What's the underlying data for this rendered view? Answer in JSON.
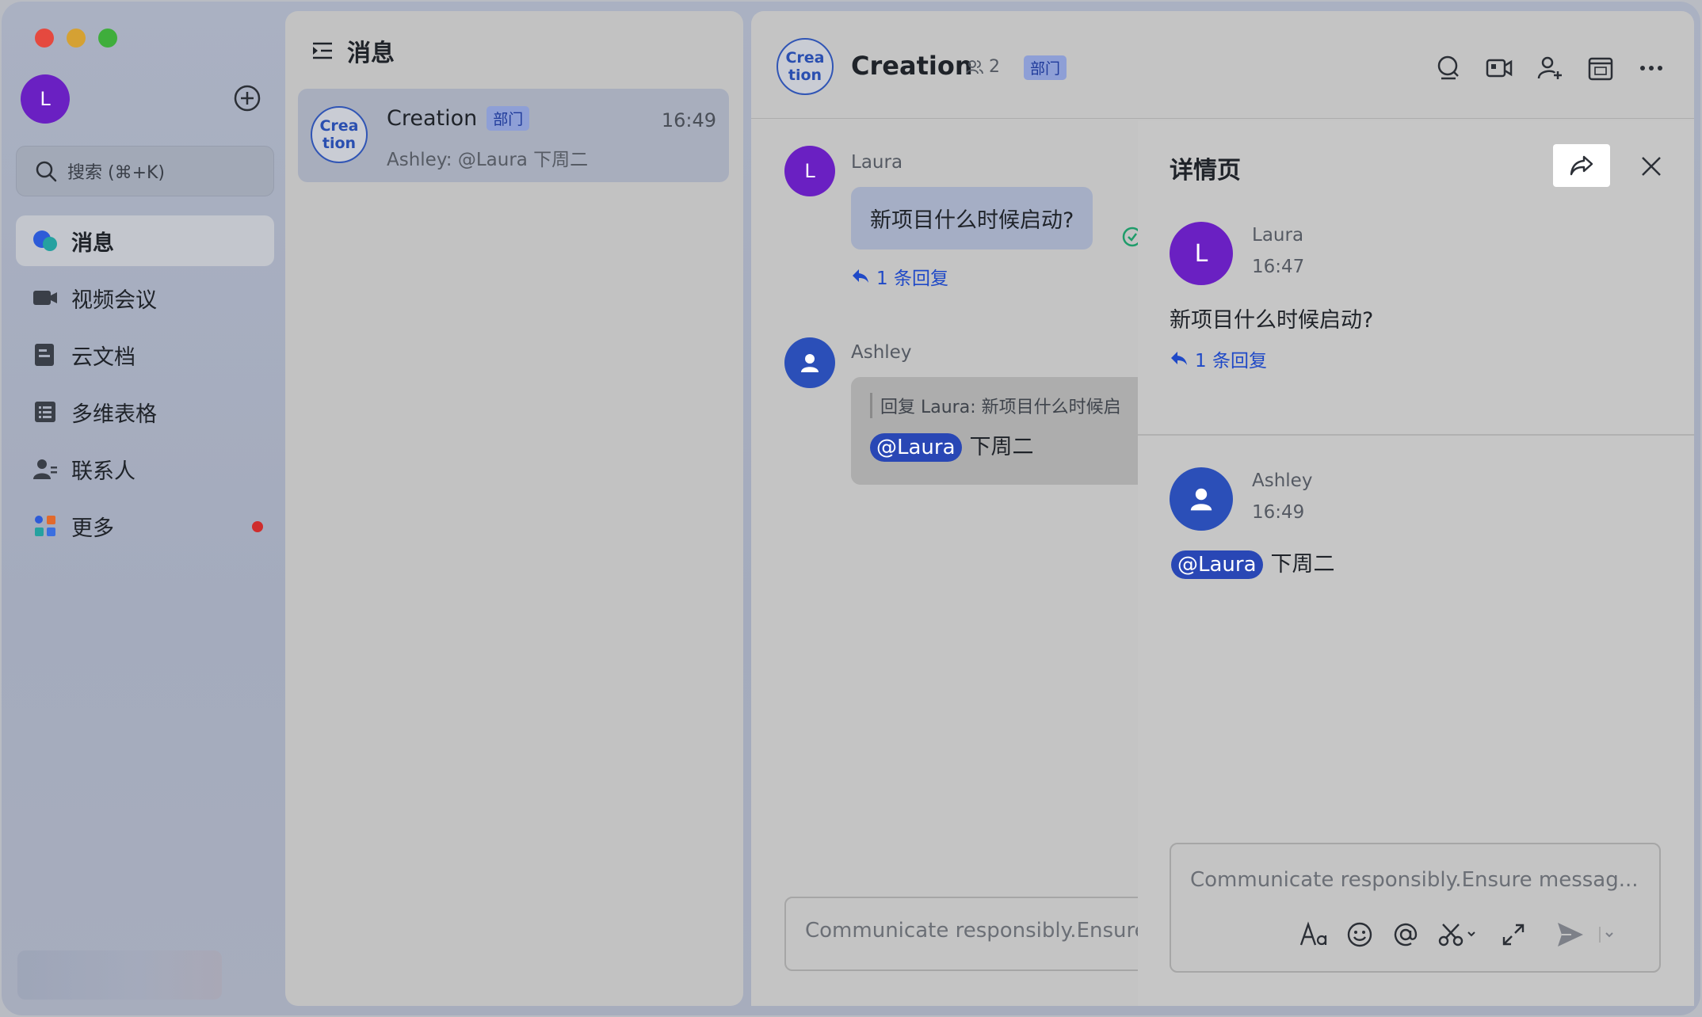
{
  "sidebar": {
    "user_initial": "L",
    "search_placeholder": "搜索 (⌘+K)",
    "items": [
      {
        "label": "消息"
      },
      {
        "label": "视频会议"
      },
      {
        "label": "云文档"
      },
      {
        "label": "多维表格"
      },
      {
        "label": "联系人"
      },
      {
        "label": "更多"
      }
    ]
  },
  "list": {
    "header": "消息",
    "conversation": {
      "avatar_text": "Crea\ntion",
      "name": "Creation",
      "badge": "部门",
      "time": "16:49",
      "preview": "Ashley: @Laura 下周二"
    }
  },
  "chat": {
    "avatar_text": "Crea\ntion",
    "title": "Creation",
    "member_count": "2",
    "badge": "部门",
    "messages": [
      {
        "sender": "Laura",
        "initial": "L",
        "text": "新项目什么时候启动?",
        "reply_link": "1 条回复"
      },
      {
        "sender": "Ashley",
        "quote": "回复 Laura:  新项目什么时候启",
        "mention": "@Laura",
        "text": "下周二"
      }
    ],
    "input_placeholder": "Communicate responsibly.Ensure"
  },
  "detail": {
    "title": "详情页",
    "root": {
      "sender": "Laura",
      "initial": "L",
      "time": "16:47",
      "text": "新项目什么时候启动?",
      "reply_link": "1 条回复"
    },
    "reply": {
      "sender": "Ashley",
      "time": "16:49",
      "mention": "@Laura",
      "text": "下周二"
    },
    "input_placeholder": "Communicate responsibly.Ensure messag..."
  },
  "colors": {
    "accent": "#1f49c7",
    "mention_bg": "#2947b5",
    "laura_avatar": "#6a20c2",
    "ashley_avatar": "#2b4fb8",
    "unread_dot": "#cf2d2d"
  }
}
